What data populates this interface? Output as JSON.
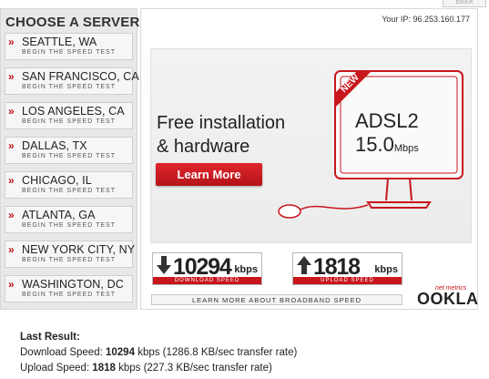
{
  "top_tab": {
    "label": "Block"
  },
  "servers": {
    "heading": "CHOOSE A SERVER:",
    "items": [
      {
        "city": "SEATTLE, WA",
        "sub": "BEGIN THE SPEED TEST"
      },
      {
        "city": "SAN FRANCISCO, CA",
        "sub": "BEGIN THE SPEED TEST"
      },
      {
        "city": "LOS ANGELES, CA",
        "sub": "BEGIN THE SPEED TEST"
      },
      {
        "city": "DALLAS, TX",
        "sub": "BEGIN THE SPEED TEST"
      },
      {
        "city": "CHICAGO, IL",
        "sub": "BEGIN THE SPEED TEST"
      },
      {
        "city": "ATLANTA, GA",
        "sub": "BEGIN THE SPEED TEST"
      },
      {
        "city": "NEW YORK CITY, NY",
        "sub": "BEGIN THE SPEED TEST"
      },
      {
        "city": "WASHINGTON, DC",
        "sub": "BEGIN THE SPEED TEST"
      }
    ],
    "arrow_glyph": "»"
  },
  "ip": {
    "text": "Your IP: 96.253.160.177"
  },
  "ad": {
    "line1": "Free installation",
    "line2": "& hardware",
    "button": "Learn More",
    "badge": "NEW",
    "product1": "ADSL2",
    "product2": "15.0",
    "product2_unit": "Mbps"
  },
  "download": {
    "value": "10294",
    "unit": "kbps",
    "caption": "DOWNLOAD SPEED",
    "icon": "arrow-down-icon"
  },
  "upload": {
    "value": "1818",
    "unit": "kbps",
    "caption": "UPLOAD SPEED",
    "icon": "arrow-up-icon"
  },
  "learn_more_bar": "LEARN MORE ABOUT BROADBAND SPEED",
  "logo": {
    "tag": "net metrics",
    "name": "OOKLA"
  },
  "results": {
    "heading": "Last Result:",
    "download_label": "Download Speed:",
    "download_value": "10294",
    "download_tail": "kbps (1286.8 KB/sec transfer rate)",
    "upload_label": "Upload Speed:",
    "upload_value": "1818",
    "upload_tail": "kbps (227.3 KB/sec transfer rate)"
  },
  "colors": {
    "accent": "#c8161d",
    "panel": "#e8e8e8"
  }
}
